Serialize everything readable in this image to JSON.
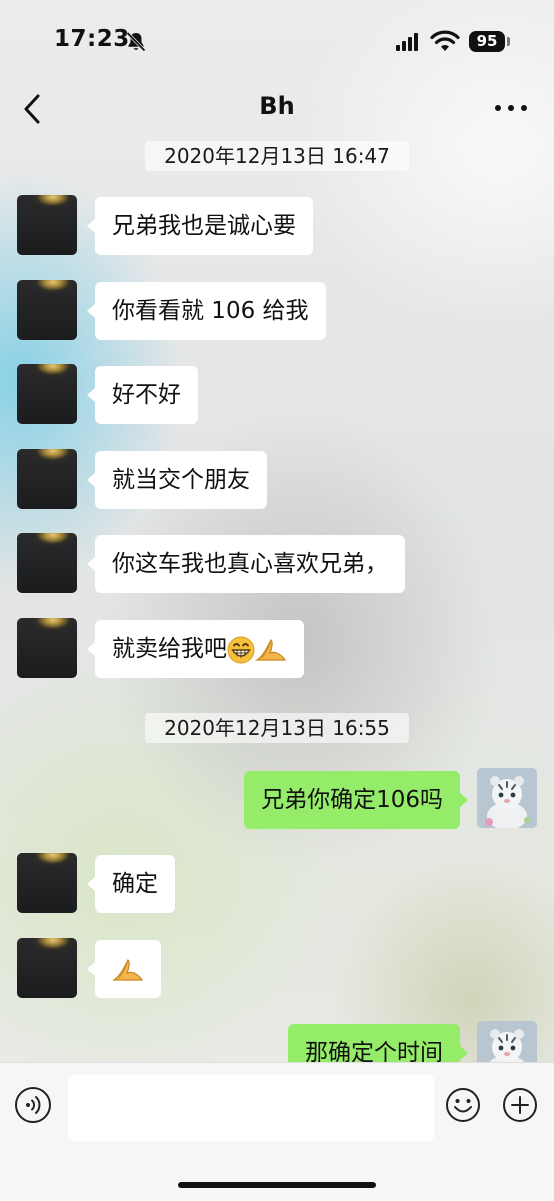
{
  "status_bar": {
    "time": "17:23",
    "battery": "95"
  },
  "nav": {
    "title": "Bh"
  },
  "timestamps": [
    "2020年12月13日 16:47",
    "2020年12月13日 16:55"
  ],
  "messages": [
    {
      "side": "left",
      "text": "兄弟我也是诚心要"
    },
    {
      "side": "left",
      "text": "你看看就 106 给我"
    },
    {
      "side": "left",
      "text": "好不好"
    },
    {
      "side": "left",
      "text": "就当交个朋友"
    },
    {
      "side": "left",
      "text": "你这车我也真心喜欢兄弟，"
    },
    {
      "side": "left",
      "text": "就卖给我吧",
      "emojis": [
        "grin-emoji",
        "folded-hands-emoji"
      ]
    },
    {
      "side": "right",
      "text": "兄弟你确定106吗"
    },
    {
      "side": "left",
      "text": "确定"
    },
    {
      "side": "left",
      "text": "",
      "emojis": [
        "folded-hands-emoji"
      ]
    },
    {
      "side": "right",
      "text": "那确定个时间"
    }
  ],
  "input": {
    "value": "",
    "placeholder": ""
  },
  "colors": {
    "own_bubble": "#95ec69",
    "other_bubble": "#ffffff"
  }
}
